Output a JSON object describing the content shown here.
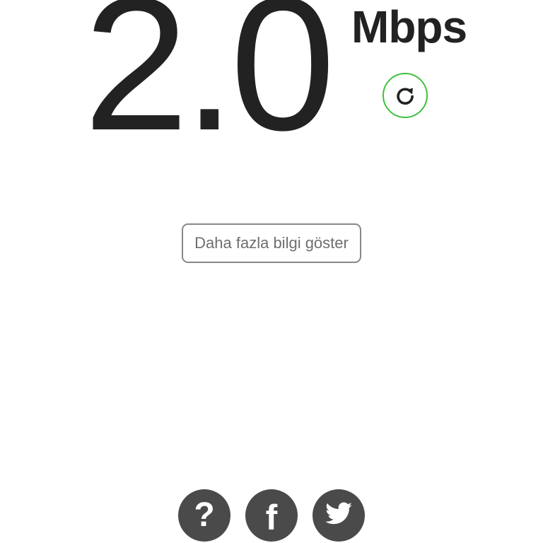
{
  "speed": {
    "value": "2.0",
    "unit": "Mbps"
  },
  "actions": {
    "refresh_icon": "refresh-icon",
    "refresh_color": "#3ec03e",
    "more_info_label": "Daha fazla bilgi göster"
  },
  "footer": {
    "help_glyph": "?",
    "facebook_glyph": "f",
    "icons": [
      "help-icon",
      "facebook-icon",
      "twitter-icon"
    ],
    "icon_background": "#4a4a4a"
  }
}
